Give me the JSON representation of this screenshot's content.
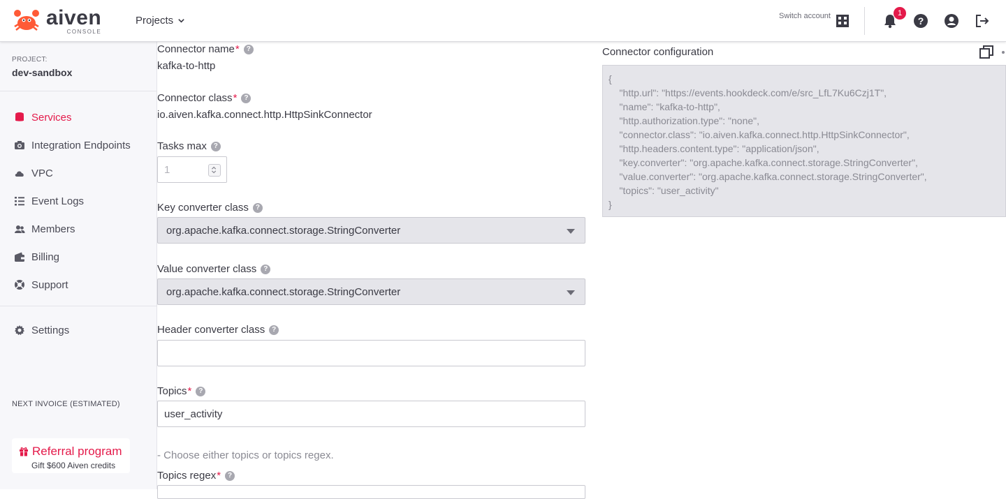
{
  "header": {
    "logo_word": "aiven",
    "logo_sub": "CONSOLE",
    "projects_label": "Projects",
    "switch_account_label": "Switch account",
    "notification_count": "1",
    "icons": [
      "building-icon",
      "bell-icon",
      "help-icon",
      "user-icon",
      "logout-icon"
    ]
  },
  "sidebar": {
    "project_label": "PROJECT:",
    "project_name": "dev-sandbox",
    "items": [
      {
        "label": "Services",
        "icon": "database-icon",
        "active": true
      },
      {
        "label": "Integration Endpoints",
        "icon": "camera-icon",
        "active": false
      },
      {
        "label": "VPC",
        "icon": "cloud-icon",
        "active": false
      },
      {
        "label": "Event Logs",
        "icon": "list-icon",
        "active": false
      },
      {
        "label": "Members",
        "icon": "users-icon",
        "active": false
      },
      {
        "label": "Billing",
        "icon": "wallet-icon",
        "active": false
      },
      {
        "label": "Support",
        "icon": "lifebuoy-icon",
        "active": false
      }
    ],
    "settings_label": "Settings",
    "invoice_label": "NEXT INVOICE (ESTIMATED)",
    "referral": {
      "title": "Referral program",
      "subtitle": "Gift $600 Aiven credits"
    }
  },
  "form": {
    "connector_name": {
      "label": "Connector name",
      "required": "*",
      "value": "kafka-to-http"
    },
    "connector_class": {
      "label": "Connector class",
      "required": "*",
      "value": "io.aiven.kafka.connect.http.HttpSinkConnector"
    },
    "tasks_max": {
      "label": "Tasks max",
      "placeholder": "1"
    },
    "key_converter": {
      "label": "Key converter class",
      "value": "org.apache.kafka.connect.storage.StringConverter"
    },
    "value_converter": {
      "label": "Value converter class",
      "value": "org.apache.kafka.connect.storage.StringConverter"
    },
    "header_converter": {
      "label": "Header converter class",
      "value": ""
    },
    "topics": {
      "label": "Topics",
      "required": "*",
      "value": "user_activity"
    },
    "hint": "- Choose either topics or topics regex.",
    "topics_regex": {
      "label": "Topics regex",
      "required": "*"
    }
  },
  "config_panel": {
    "title": "Connector configuration",
    "lines": [
      "{",
      "    \"http.url\": \"https://events.hookdeck.com/e/src_LfL7Ku6Czj1T\",",
      "    \"name\": \"kafka-to-http\",",
      "    \"http.authorization.type\": \"none\",",
      "    \"connector.class\": \"io.aiven.kafka.connect.http.HttpSinkConnector\",",
      "    \"http.headers.content.type\": \"application/json\",",
      "    \"key.converter\": \"org.apache.kafka.connect.storage.StringConverter\",",
      "    \"value.converter\": \"org.apache.kafka.connect.storage.StringConverter\",",
      "    \"topics\": \"user_activity\"",
      "}"
    ]
  },
  "colors": {
    "accent": "#e41a4a",
    "text": "#3a3a44",
    "sidebar_bg": "#f7f7fa",
    "select_bg": "#e5e5ea"
  }
}
